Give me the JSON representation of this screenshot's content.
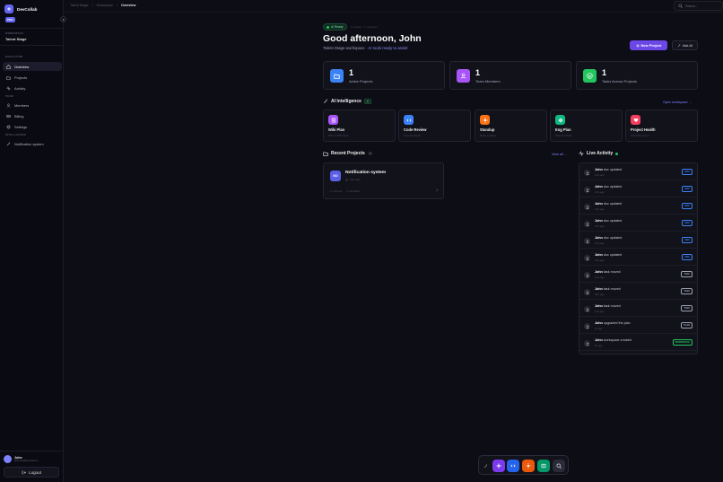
{
  "app": {
    "name": "DevCollab",
    "plan_badge": "PRO"
  },
  "sidebar": {
    "workspace_label": "WORKSPACE",
    "workspace_name": "Talent Stage",
    "nav_label": "NAVIGATION",
    "nav_items": [
      {
        "label": "Overview",
        "icon": "home-icon"
      },
      {
        "label": "Projects",
        "icon": "folder-icon"
      },
      {
        "label": "Activity",
        "icon": "pulse-icon"
      }
    ],
    "team_label": "TEAM",
    "team_items": [
      {
        "label": "Members",
        "icon": "users-icon"
      },
      {
        "label": "Billing",
        "icon": "card-icon"
      },
      {
        "label": "Settings",
        "icon": "gear-icon"
      }
    ],
    "intel_label": "INTELLIGENCE",
    "intel_items": [
      {
        "label": "Notification system",
        "icon": "wand-icon"
      }
    ],
    "user": {
      "name": "John",
      "email": "john.doe@devcollab.io"
    },
    "logout_label": "Logout"
  },
  "topbar": {
    "breadcrumbs": [
      "Talent Stage",
      "/",
      "Workspace",
      "/",
      "Overview"
    ],
    "search_placeholder": "Search..."
  },
  "header": {
    "ai_badge": "AI Ready",
    "meta": "1 project · 1 members",
    "greeting": "Good afternoon, John",
    "workspace": "Talent Stage workspace",
    "separator": " · ",
    "ai_note": "AI tools ready to assist",
    "new_project": "New Project",
    "ask_ai": "Ask AI"
  },
  "stats": [
    {
      "value": "1",
      "label": "Active Projects",
      "color": "#3b82f6",
      "icon": "folder-icon"
    },
    {
      "value": "1",
      "label": "Team Members",
      "color": "#a855f7",
      "icon": "users-icon"
    },
    {
      "value": "1",
      "label": "Tasks Across Projects",
      "color": "#22c55e",
      "icon": "check-circle-icon"
    }
  ],
  "ai_section": {
    "title": "AI Intelligence",
    "badge": "4",
    "link": "Open workspace →"
  },
  "tools": [
    {
      "name": "Wiki Plan",
      "sub": "Plan & Wiki docs",
      "color": "#a855f7",
      "icon": "wiki-icon"
    },
    {
      "name": "Code Review",
      "sub": "AI code check",
      "color": "#3b82f6",
      "icon": "code-icon"
    },
    {
      "name": "Standup",
      "sub": "Daily updates",
      "color": "#f97316",
      "icon": "sun-icon"
    },
    {
      "name": "Eng Plan",
      "sub": "Plan the build",
      "color": "#10b981",
      "icon": "plan-icon"
    },
    {
      "name": "Project Health",
      "sub": "AI health report",
      "color": "#f43f5e",
      "icon": "heart-icon"
    }
  ],
  "recent": {
    "title": "Recent Projects",
    "count": "1",
    "view_all": "View all →",
    "projects": [
      {
        "initials": "NO",
        "name": "Notification system",
        "time": "13m ago",
        "members": "1 member",
        "progress": "0 subtasks"
      }
    ]
  },
  "activity": {
    "title": "Live Activity",
    "items": [
      {
        "user": "John",
        "action": "doc updated",
        "time": "13m ago",
        "tag": "DOC",
        "tag_color": "#3b82f6"
      },
      {
        "user": "John",
        "action": "doc updated",
        "time": "13m ago",
        "tag": "DOC",
        "tag_color": "#3b82f6"
      },
      {
        "user": "John",
        "action": "doc updated",
        "time": "13m ago",
        "tag": "DOC",
        "tag_color": "#3b82f6"
      },
      {
        "user": "John",
        "action": "doc updated",
        "time": "13m ago",
        "tag": "DOC",
        "tag_color": "#3b82f6"
      },
      {
        "user": "John",
        "action": "doc updated",
        "time": "13m ago",
        "tag": "DOC",
        "tag_color": "#3b82f6"
      },
      {
        "user": "John",
        "action": "doc updated",
        "time": "13m ago",
        "tag": "DOC",
        "tag_color": "#3b82f6"
      },
      {
        "user": "John",
        "action": "task moved",
        "time": "13m ago",
        "tag": "TASK",
        "tag_color": "#9ca3af"
      },
      {
        "user": "John",
        "action": "task moved",
        "time": "13m ago",
        "tag": "TASK",
        "tag_color": "#9ca3af"
      },
      {
        "user": "John",
        "action": "task moved",
        "time": "13m ago",
        "tag": "TASK",
        "tag_color": "#9ca3af"
      },
      {
        "user": "John",
        "action": "upgraded the plan",
        "time": "1h ago",
        "tag": "PLAN",
        "tag_color": "#9ca3af"
      },
      {
        "user": "John",
        "action": "workspace created",
        "time": "1h ago",
        "tag": "WORKSPACE",
        "tag_color": "#22c55e"
      }
    ]
  },
  "dock": [
    {
      "icon": "add-icon",
      "color": "#7c3aed"
    },
    {
      "icon": "code-icon",
      "color": "#2563eb"
    },
    {
      "icon": "sun-icon",
      "color": "#ea580c"
    },
    {
      "icon": "book-icon",
      "color": "#059669"
    },
    {
      "icon": "search-icon",
      "color": "#2a2a38"
    }
  ]
}
